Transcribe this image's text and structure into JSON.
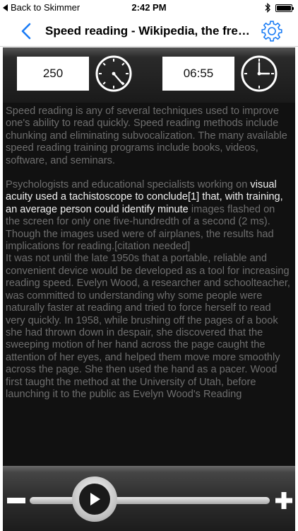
{
  "status_bar": {
    "back_label": "Back to Skimmer",
    "time": "2:42 PM"
  },
  "nav": {
    "title": "Speed reading - Wikipedia, the free encyclopedia"
  },
  "controls_top": {
    "wpm": "250",
    "time_remaining": "06:55"
  },
  "article": {
    "para1": "Speed reading is any of several techniques used to improve one's ability to read quickly. Speed reading methods include chunking and eliminating subvocalization. The many available speed reading training programs include books, videos, software, and seminars.",
    "para2_before": "Psychologists and educational specialists working on ",
    "para2_highlight": "visual acuity used a tachistoscope to conclude[1] that, with training, an average person could identify minute",
    "para2_after": " images flashed on the screen for only one five-hundredth of a second (2 ms). Though the images used were of airplanes, the results had implications for reading.[citation needed]",
    "para3": "It was not until the late 1950s that a portable, reliable and convenient device would be developed as a tool for increasing reading speed. Evelyn Wood, a researcher and schoolteacher, was committed to understanding why some people were naturally faster at reading and tried to force herself to read very quickly. In 1958, while brushing off the pages of a book she had thrown down in despair, she discovered that the sweeping motion of her hand across the page caught the attention of her eyes, and helped them move more smoothly across the page. She then used the hand as a pacer. Wood first taught the method at the University of Utah, before launching it to the public as Evelyn Wood's Reading"
  },
  "playback": {
    "progress": 0.27
  },
  "colors": {
    "accent": "#1a7cf5",
    "reader_bg": "#111111",
    "text_dim": "#6e6e6e",
    "text_highlight": "#f2f2f2"
  },
  "icons": {
    "status_back": "back-triangle-icon",
    "bluetooth": "bluetooth-icon",
    "battery": "battery-icon",
    "nav_back": "chevron-left-icon",
    "settings": "gear-icon",
    "wpm": "clock-dial-icon",
    "time": "clock-icon",
    "play": "play-icon",
    "minus": "minus-icon",
    "plus": "plus-icon"
  }
}
